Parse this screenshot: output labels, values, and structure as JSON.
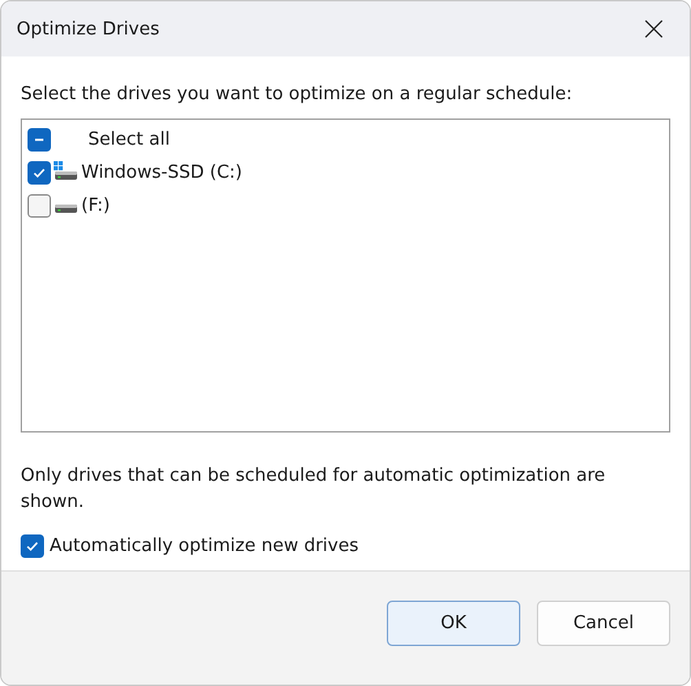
{
  "window": {
    "title": "Optimize Drives"
  },
  "instruction": "Select the drives you want to optimize on a regular schedule:",
  "drives": [
    {
      "kind": "select_all",
      "label": "Select all",
      "indeterminate": true
    },
    {
      "kind": "drive",
      "label": "Windows-SSD (C:)",
      "checked": true,
      "system": true
    },
    {
      "kind": "drive",
      "label": "(F:)",
      "checked": false,
      "system": false
    }
  ],
  "note": "Only drives that can be scheduled for automatic optimization are shown.",
  "auto_optimize": {
    "label": "Automatically optimize new drives",
    "checked": true
  },
  "buttons": [
    {
      "label": "OK",
      "default": true
    },
    {
      "label": "Cancel",
      "default": false
    }
  ]
}
